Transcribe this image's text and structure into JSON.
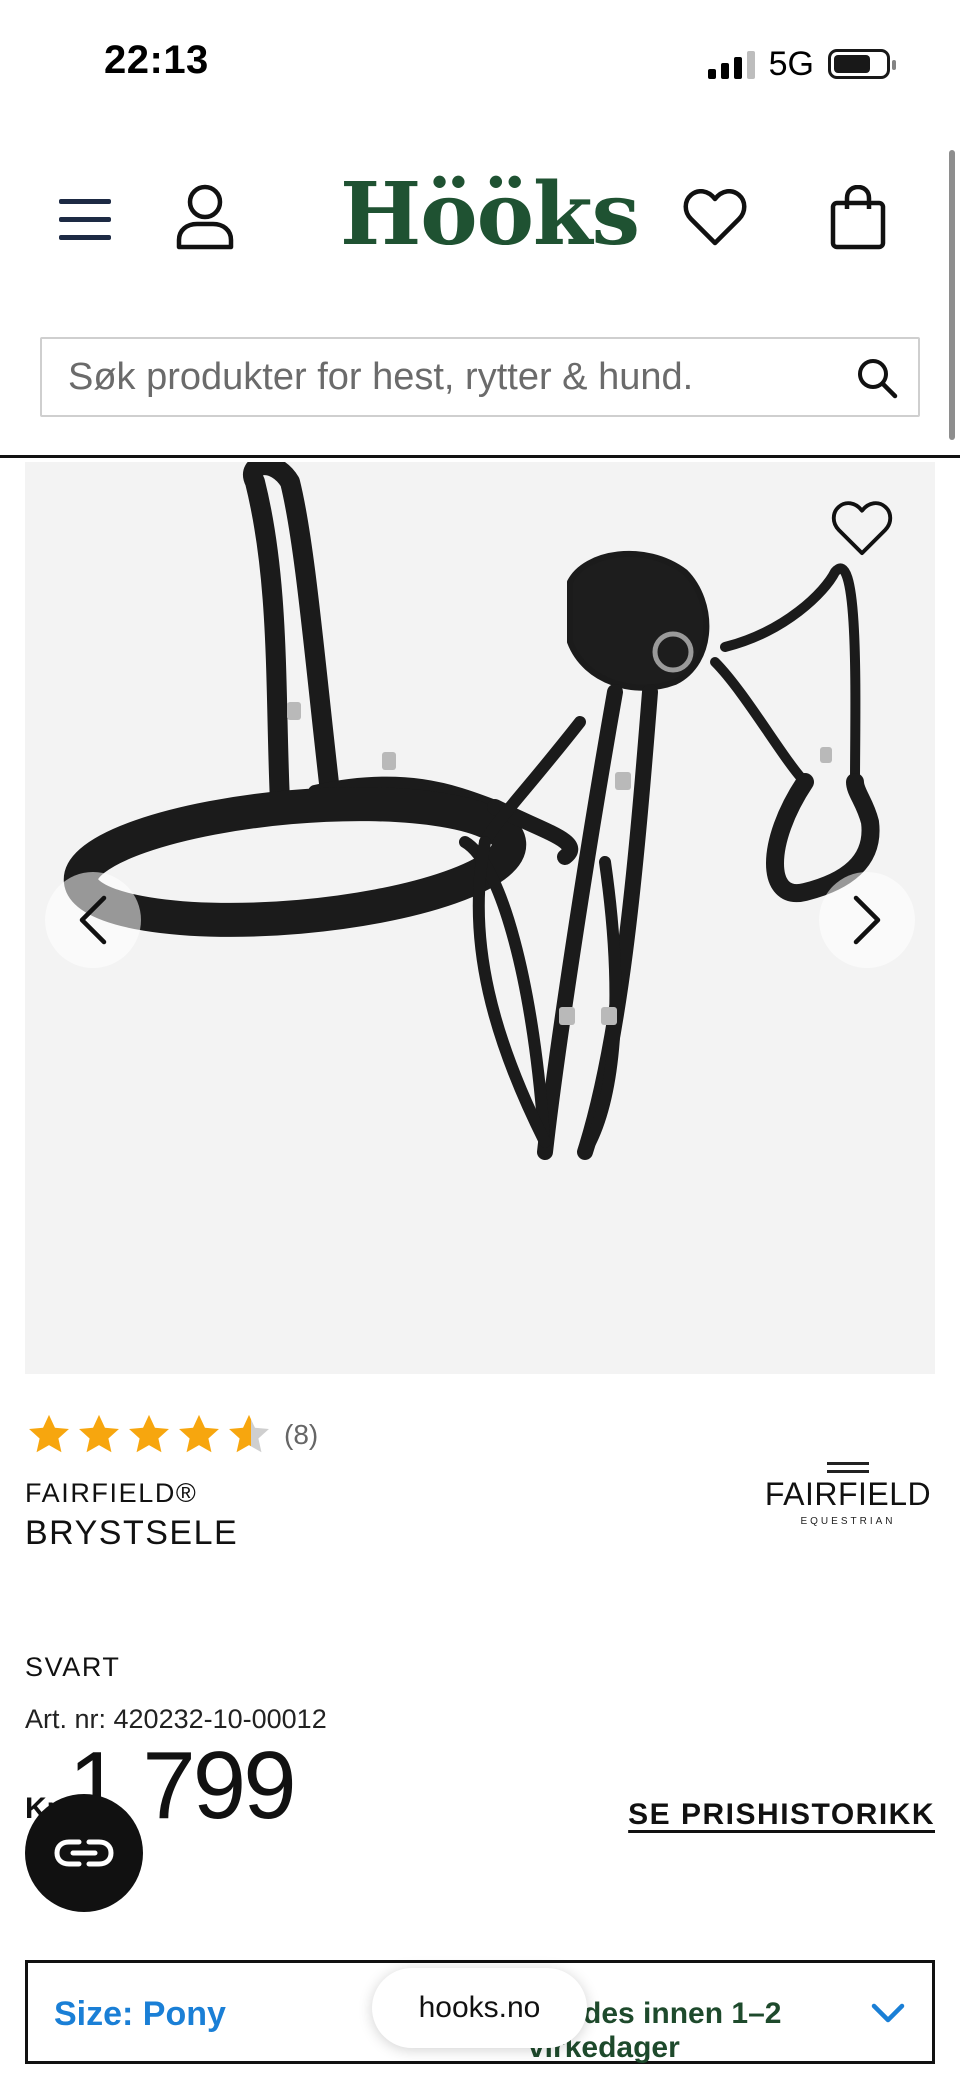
{
  "status_bar": {
    "time": "22:13",
    "network": "5G"
  },
  "header": {
    "logo": "Hööks",
    "search_placeholder": "Søk produkter for hest, rytter & hund."
  },
  "product": {
    "rating_count": "(8)",
    "rating_value": 4.5,
    "rating_max": 5,
    "brand": "FAIRFIELD®",
    "title": "BRYSTSELE",
    "brand_logo_main": "FAIRFIELD",
    "brand_logo_sub": "EQUESTRIAN",
    "color": "SVART",
    "article_number": "Art. nr: 420232-10-00012",
    "price_currency": "Kr",
    "price_value": "1 799",
    "price_history_link": "SE PRISHISTORIKK"
  },
  "size_selector": {
    "label": "Size: Pony",
    "delivery": "Sendes innen 1–2 virkedager"
  },
  "browser": {
    "url": "hooks.no"
  },
  "colors": {
    "brand_green": "#1f5232",
    "link_blue": "#1a7fd6",
    "star_gold": "#f7a60e"
  },
  "icons": [
    "menu-icon",
    "user-icon",
    "heart-icon",
    "bag-icon",
    "search-icon",
    "chevron-left-icon",
    "chevron-right-icon",
    "chat-icon",
    "chevron-down-icon",
    "star-icon"
  ]
}
